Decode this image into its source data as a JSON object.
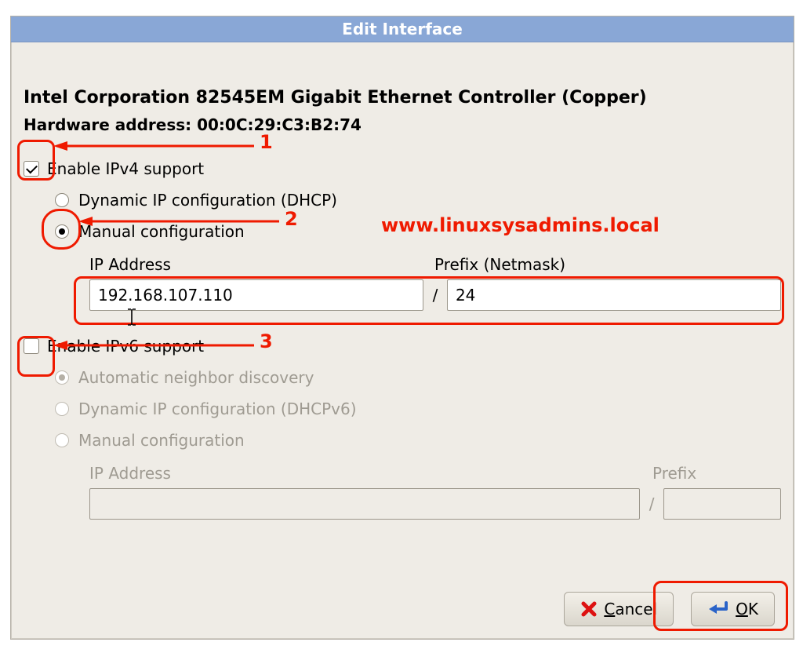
{
  "dialog": {
    "title": "Edit Interface",
    "device_name": "Intel Corporation 82545EM Gigabit Ethernet Controller (Copper)",
    "hardware_address_label": "Hardware address: 00:0C:29:C3:B2:74"
  },
  "ipv4": {
    "enable_label": "Enable IPv4 support",
    "enabled": true,
    "options": {
      "dhcp_label": "Dynamic IP configuration (DHCP)",
      "manual_label": "Manual configuration",
      "selected": "manual"
    },
    "ip_label": "IP Address",
    "prefix_label": "Prefix (Netmask)",
    "ip_value": "192.168.107.110",
    "prefix_value": "24"
  },
  "ipv6": {
    "enable_label": "Enable IPv6 support",
    "enabled": false,
    "options": {
      "auto_label": "Automatic neighbor discovery",
      "dhcpv6_label": "Dynamic IP configuration (DHCPv6)",
      "manual_label": "Manual configuration",
      "selected": "auto"
    },
    "ip_label": "IP Address",
    "prefix_label": "Prefix",
    "ip_value": "",
    "prefix_value": ""
  },
  "slash": "/",
  "buttons": {
    "cancel_label": "Cancel",
    "ok_label": "OK",
    "ok_underline": "O",
    "cancel_underline": "C"
  },
  "annotations": {
    "n1": "1",
    "n2": "2",
    "n3": "3",
    "watermark": "www.linuxsysadmins.local"
  },
  "colors": {
    "annotation_red": "#ef1a00",
    "titlebar_bg": "#89a7d6",
    "dialog_bg": "#efece6"
  }
}
